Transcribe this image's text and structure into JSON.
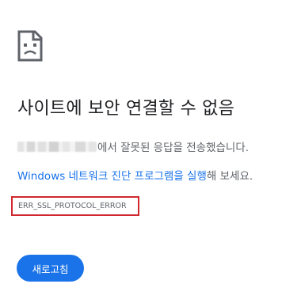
{
  "icon": "sad-page-icon",
  "title": "사이트에 보안 연결할 수 없음",
  "message": {
    "host_redacted": true,
    "text": "에서 잘못된 응답을 전송했습니다."
  },
  "suggestion": {
    "link_text": "Windows 네트워크 진단 프로그램을 실행",
    "rest_text": "해 보세요."
  },
  "error_code": "ERR_SSL_PROTOCOL_ERROR",
  "reload_button_label": "새로고침",
  "colors": {
    "link": "#1a73e8",
    "button_bg": "#1a73e8",
    "highlight_border": "#d0282e",
    "text": "#202124",
    "secondary_text": "#5f6368"
  }
}
